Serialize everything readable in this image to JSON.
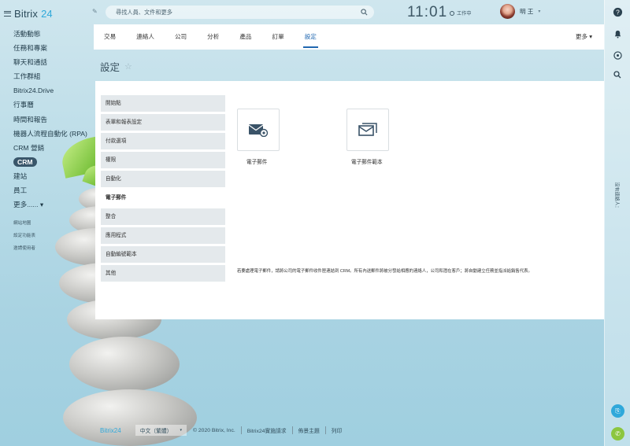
{
  "app": {
    "logo_text": "Bitrix",
    "logo_num": "24"
  },
  "sidebar": {
    "items": [
      {
        "label": "活動動態"
      },
      {
        "label": "任務和專案"
      },
      {
        "label": "聊天和通話"
      },
      {
        "label": "工作群組"
      },
      {
        "label": "Bitrix24.Drive"
      },
      {
        "label": "行事曆"
      },
      {
        "label": "時間和報告"
      },
      {
        "label": "機器人流程自動化 (RPA)"
      },
      {
        "label": "CRM 營銷"
      },
      {
        "label": "CRM"
      },
      {
        "label": "建站"
      },
      {
        "label": "員工"
      },
      {
        "label": "更多...... ▾"
      }
    ],
    "sub_links": [
      "網站地圖",
      "設定功能表",
      "邀請使用者"
    ]
  },
  "topbar": {
    "search_placeholder": "尋找人員、文件和更多",
    "clock": "11:01",
    "work_status": "工作中",
    "user_name": "明 王"
  },
  "rail": {
    "vertical_text": "沒有連絡人："
  },
  "tabs": {
    "items": [
      "交易",
      "連絡人",
      "公司",
      "分析",
      "產品",
      "訂單",
      "設定"
    ],
    "active": "設定",
    "more": "更多 ▾"
  },
  "page": {
    "title": "設定"
  },
  "settings_menu": {
    "items": [
      "開始點",
      "表單和報表設定",
      "付款選項",
      "權限",
      "自動化",
      "電子郵件",
      "整合",
      "應用程式",
      "自動編號範本",
      "其他"
    ],
    "active_index": 5
  },
  "cards": [
    {
      "label": "電子郵件",
      "icon": "email-settings-icon"
    },
    {
      "label": "電子郵件範本",
      "icon": "email-template-icon"
    }
  ],
  "notice": "若要處理電子郵件，請將公司的電子郵件收件匣連結到 CRM。所有內送郵件將被分發給相應的連絡人，公司和潛在客戶；將自動建立任務並指派給銷售代表。",
  "footer": {
    "logo": "Bitrix24",
    "language": "中文（繁體）",
    "copyright": "© 2020 Bitrix, Inc.",
    "links": [
      "Bitrix24實施請求",
      "佈景主題",
      "列印"
    ]
  },
  "colors": {
    "accent": "#2067b0",
    "brand": "#2fa8da",
    "active_nav_bg": "#39566a"
  }
}
